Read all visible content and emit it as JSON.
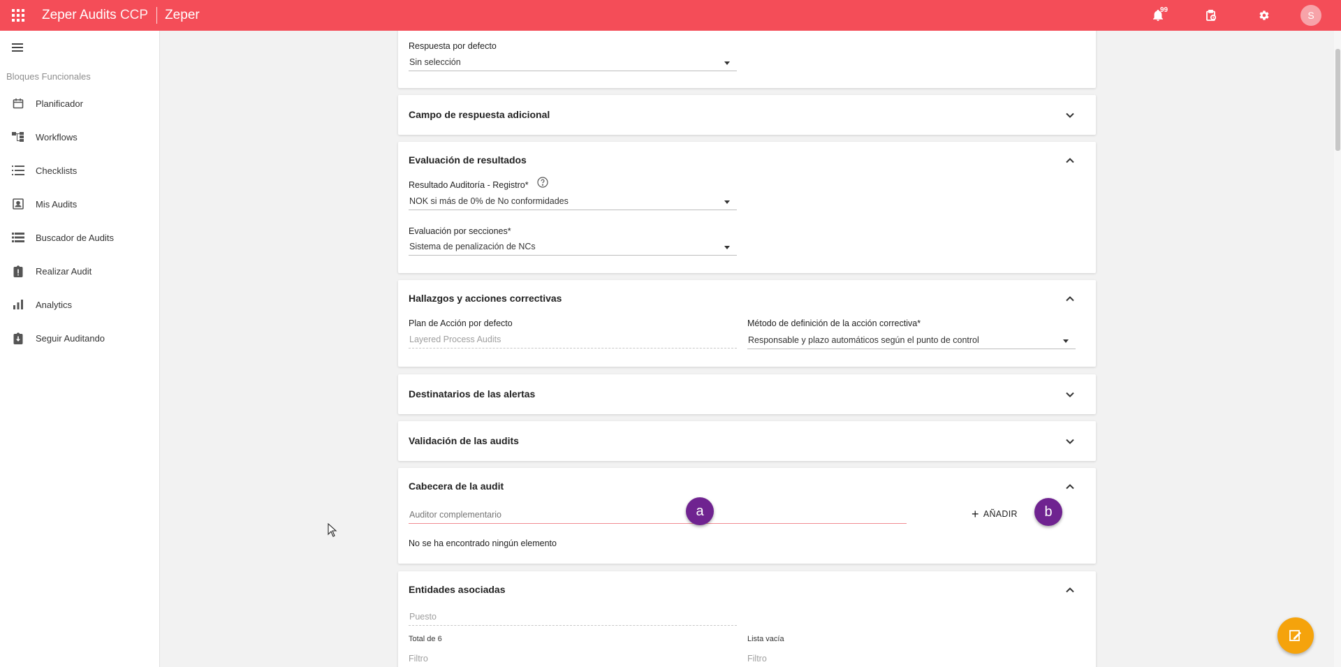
{
  "topbar": {
    "app_name": "Zeper Audits",
    "app_suffix": "CCP",
    "tenant": "Zeper",
    "notification_count": "99",
    "avatar_initial": "S",
    "color": "#f44d58"
  },
  "sidebar": {
    "section_label": "Bloques Funcionales",
    "items": [
      {
        "label": "Planificador",
        "icon": "calendar-icon"
      },
      {
        "label": "Workflows",
        "icon": "workflow-icon"
      },
      {
        "label": "Checklists",
        "icon": "checklist-icon"
      },
      {
        "label": "Mis Audits",
        "icon": "contact-card-icon"
      },
      {
        "label": "Buscador de Audits",
        "icon": "list-icon"
      },
      {
        "label": "Realizar Audit",
        "icon": "clipboard-alert-icon"
      },
      {
        "label": "Analytics",
        "icon": "bar-chart-icon"
      },
      {
        "label": "Seguir Auditando",
        "icon": "clipboard-download-icon"
      }
    ]
  },
  "respuesta": {
    "label": "Respuesta por defecto",
    "value": "Sin selección"
  },
  "campo_adicional": {
    "title": "Campo de respuesta adicional"
  },
  "evaluacion": {
    "title": "Evaluación de resultados",
    "resultado_label": "Resultado Auditoría - Registro*",
    "resultado_value": "NOK si más de 0% de No conformidades",
    "secciones_label": "Evaluación por secciones*",
    "secciones_value": "Sistema de penalización de NCs"
  },
  "hallazgos": {
    "title": "Hallazgos y acciones correctivas",
    "plan_label": "Plan de Acción por defecto",
    "plan_value": "Layered Process Audits",
    "metodo_label": "Método de definición de la acción correctiva*",
    "metodo_value": "Responsable y plazo automáticos según el punto de control"
  },
  "destinatarios": {
    "title": "Destinatarios de las alertas"
  },
  "validacion": {
    "title": "Validación de las audits"
  },
  "cabecera": {
    "title": "Cabecera de la audit",
    "auditor_placeholder": "Auditor complementario",
    "add_label": "AÑADIR",
    "empty_text": "No se ha encontrado ningún elemento",
    "badge_a": "a",
    "badge_b": "b"
  },
  "entidades": {
    "title": "Entidades asociadas",
    "puesto_placeholder": "Puesto",
    "total_label": "Total de 6",
    "lista_label": "Lista vacía",
    "filtro_left": "Filtro",
    "filtro_right": "Filtro"
  },
  "fab": {
    "icon": "edit-note-icon",
    "color": "#f5a30c"
  }
}
